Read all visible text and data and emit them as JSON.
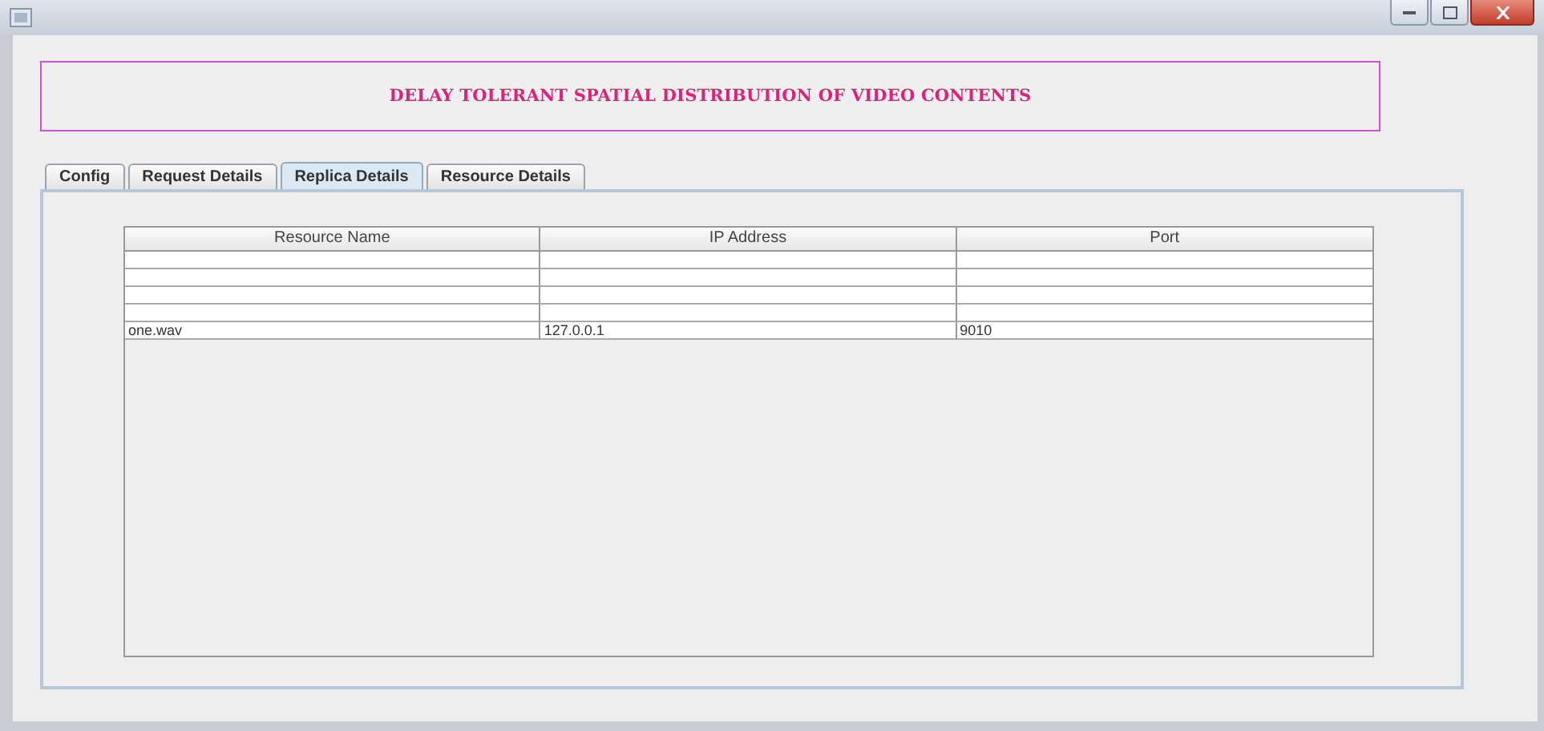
{
  "banner": {
    "title": "DELAY TOLERANT SPATIAL DISTRIBUTION OF VIDEO CONTENTS"
  },
  "tabs": [
    {
      "label": "Config",
      "selected": false
    },
    {
      "label": "Request Details",
      "selected": false
    },
    {
      "label": "Replica Details",
      "selected": true
    },
    {
      "label": "Resource Details",
      "selected": false
    }
  ],
  "table": {
    "columns": [
      "Resource Name",
      "IP Address",
      "Port"
    ],
    "rows": [
      {
        "kind": "empty"
      },
      {
        "kind": "empty"
      },
      {
        "kind": "empty"
      },
      {
        "kind": "empty"
      },
      {
        "kind": "data",
        "cells": [
          "one.wav",
          "127.0.0.1",
          "9010"
        ]
      }
    ]
  }
}
